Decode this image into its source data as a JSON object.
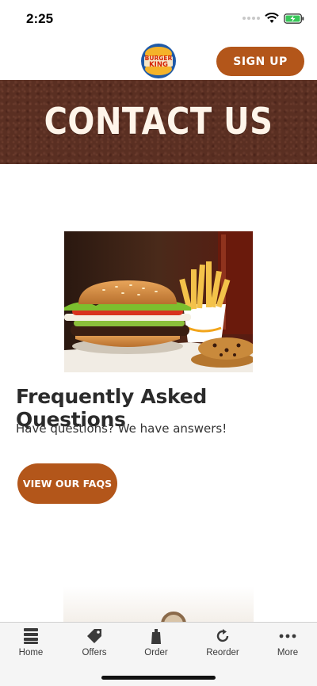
{
  "status_bar": {
    "time": "2:25"
  },
  "header": {
    "logo_alt": "BURGER KING",
    "signup_label": "SIGN UP"
  },
  "hero": {
    "title": "CONTACT US"
  },
  "faq": {
    "title": "Frequently Asked Questions",
    "subtitle": "Have questions? We have answers!",
    "button_label": "VIEW OUR FAQS"
  },
  "tab_bar": {
    "items": [
      {
        "label": "Home",
        "icon": "home-icon"
      },
      {
        "label": "Offers",
        "icon": "tag-icon"
      },
      {
        "label": "Order",
        "icon": "bag-icon"
      },
      {
        "label": "Reorder",
        "icon": "reorder-icon"
      },
      {
        "label": "More",
        "icon": "more-icon"
      }
    ]
  },
  "colors": {
    "brand_button": "#b3561a",
    "hero_bg": "#5a2f22"
  }
}
